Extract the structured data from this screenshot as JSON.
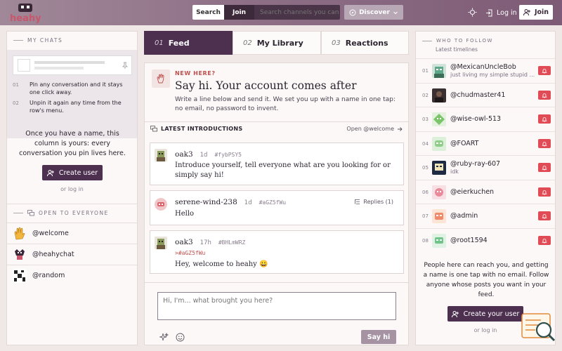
{
  "topbar": {
    "logo_text": "heahy",
    "search_tab": "Search",
    "join_tab": "Join",
    "search_placeholder": "Search channels you can",
    "discover_label": "Discover",
    "login_label": "Log in",
    "join_label": "Join"
  },
  "left": {
    "my_chats": "My chats",
    "tip1": "Pin any conversation and it stays one click away.",
    "tip2": "Unpin it again any time from the row's menu.",
    "tip1_num": "01",
    "tip2_num": "02",
    "blurb": "Once you have a name, this column is yours: every conversation you pin lives here.",
    "create_user": "Create user",
    "or_login": "or log in",
    "open_heading": "Open to everyone",
    "channels": [
      {
        "name": "@welcome",
        "icon": "waving-hand-icon"
      },
      {
        "name": "@heahychat",
        "icon": "heahy-logo-icon"
      },
      {
        "name": "@random",
        "icon": "random-pattern-icon"
      }
    ]
  },
  "tabs": [
    {
      "num": "01",
      "label": "Feed",
      "active": true
    },
    {
      "num": "02",
      "label": "My Library",
      "active": false
    },
    {
      "num": "03",
      "label": "Reactions",
      "active": false
    }
  ],
  "hero": {
    "kicker": "NEW HERE?",
    "title": "Say hi. Your account comes after",
    "body": "Write a line below and send it. We set you up with a name in one tap: no email, no password to invent."
  },
  "intro": {
    "heading": "LATEST INTRODUCTIONS",
    "open_link": "Open @welcome"
  },
  "posts": [
    {
      "author": "oak3",
      "age": "1d",
      "hash": "#fybPSY5",
      "reply_ref": "",
      "replies": "",
      "text": "Introduce yourself,  tell everyone what are you looking for or simply say hi!"
    },
    {
      "author": "serene-wind-238",
      "age": "1d",
      "hash": "#aGZ5fWu",
      "reply_ref": "",
      "replies": "Replies (1)",
      "text": "Hello"
    },
    {
      "author": "oak3",
      "age": "17h",
      "hash": "#BHLmWRZ",
      "reply_ref": ">#aGZ5fWu",
      "replies": "",
      "text": "Hey, welcome to heahy 😀"
    }
  ],
  "composer": {
    "placeholder": "Hi, I'm... what brought you here?",
    "send_label": "Say hi"
  },
  "right": {
    "heading": "Who to follow",
    "subheading": "Latest timelines",
    "users": [
      {
        "idx": "01",
        "handle": "@MexicanUncleBob",
        "bio": "just living my simple stupid ..."
      },
      {
        "idx": "02",
        "handle": "@chudmaster41",
        "bio": ""
      },
      {
        "idx": "03",
        "handle": "@wise-owl-513",
        "bio": ""
      },
      {
        "idx": "04",
        "handle": "@FOART",
        "bio": ""
      },
      {
        "idx": "05",
        "handle": "@ruby-ray-607",
        "bio": "idk"
      },
      {
        "idx": "06",
        "handle": "@eierkuchen",
        "bio": ""
      },
      {
        "idx": "07",
        "handle": "@admin",
        "bio": ""
      },
      {
        "idx": "08",
        "handle": "@root1594",
        "bio": ""
      }
    ],
    "blurb": "People here can reach you, and getting a name is one tap with no email. Follow anyone whose posts you want in your feed.",
    "create_btn": "Create your user",
    "or_login": "or log in"
  },
  "colors": {
    "accent": "#4d3050",
    "bell": "#e14b56",
    "kicker": "#c0504d"
  }
}
